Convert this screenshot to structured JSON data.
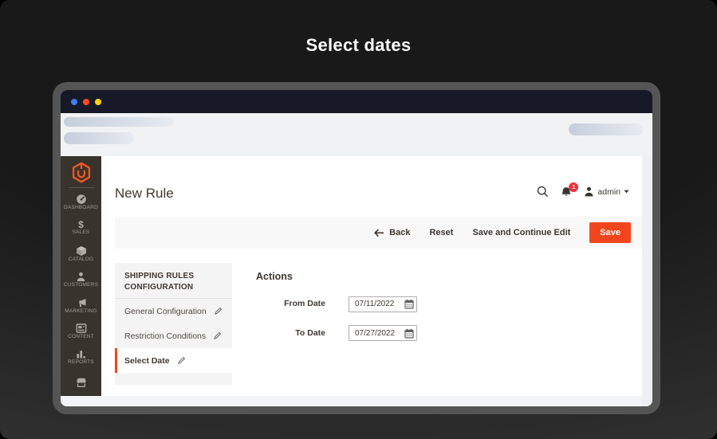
{
  "stage": {
    "title": "Select dates"
  },
  "window": {
    "traffic_lights": [
      "#3f7cf6",
      "#fb4a1f",
      "#ffd50d"
    ],
    "titlebar_color": "#171a26"
  },
  "app": {
    "sidebar": {
      "logo_icon": "magento-logo-icon",
      "items": [
        {
          "label": "DASHBOARD",
          "icon": "dashboard-icon"
        },
        {
          "label": "SALES",
          "icon": "sales-icon"
        },
        {
          "label": "CATALOG",
          "icon": "catalog-icon"
        },
        {
          "label": "CUSTOMERS",
          "icon": "customers-icon"
        },
        {
          "label": "MARKETING",
          "icon": "marketing-icon"
        },
        {
          "label": "CONTENT",
          "icon": "content-icon"
        },
        {
          "label": "REPORTS",
          "icon": "reports-icon"
        },
        {
          "label": "",
          "icon": "stores-icon"
        }
      ]
    },
    "header": {
      "title": "New Rule",
      "notification_count": "1",
      "user": "admin",
      "icons": [
        "search-icon",
        "bell-icon",
        "user-icon",
        "caret-down-icon"
      ]
    },
    "toolbar": {
      "back": "Back",
      "reset": "Reset",
      "save_and_continue": "Save and Continue Edit",
      "save": "Save"
    },
    "config_panel": {
      "title": "SHIPPING RULES CONFIGURATION",
      "items": [
        {
          "label": "General Configuration",
          "icon": "pencil-icon",
          "active": false
        },
        {
          "label": "Restriction Conditions",
          "icon": "pencil-icon",
          "active": false
        },
        {
          "label": "Select Date",
          "icon": "pencil-icon",
          "active": true
        }
      ]
    },
    "form": {
      "title": "Actions",
      "fields": [
        {
          "label": "From Date",
          "value": "07/11/2022",
          "icon": "calendar-icon"
        },
        {
          "label": "To Date",
          "value": "07/27/2022",
          "icon": "calendar-icon"
        }
      ]
    }
  },
  "colors": {
    "accent_orange": "#f1461d",
    "magento_logo_orange": "#f3571f",
    "badge_red": "#e8353d",
    "sidebar_bg": "#39332e",
    "heading_text": "#41362f",
    "toolbar_strip": "#f8f8f8",
    "panel_bg": "#f4f4f4"
  }
}
